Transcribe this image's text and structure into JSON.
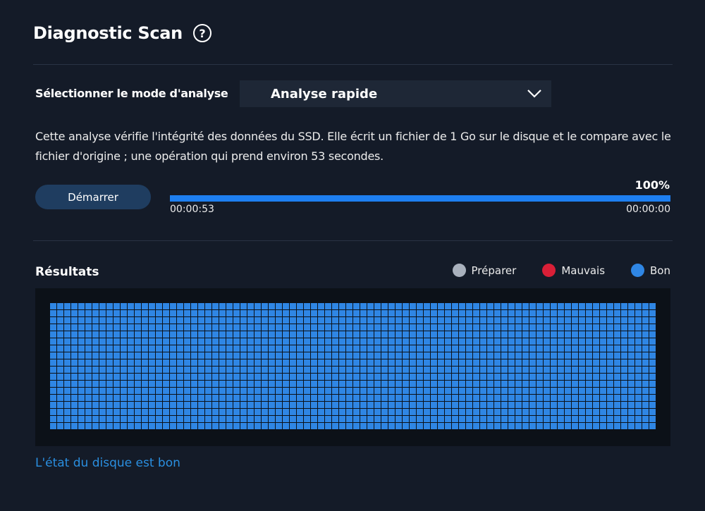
{
  "header": {
    "title": "Diagnostic Scan",
    "help_icon": "question-circle-icon",
    "help_glyph": "?"
  },
  "mode": {
    "label": "Sélectionner le mode d'analyse",
    "selected": "Analyse rapide",
    "dropdown_icon": "chevron-down-icon"
  },
  "description": "Cette analyse vérifie l'intégrité des données du SSD. Elle écrit un fichier de 1 Go sur le disque et le compare avec le fichier d'origine ; une opération qui prend environ 53 secondes.",
  "scan": {
    "start_label": "Démarrer",
    "progress_fraction": 1.0,
    "progress_text": "100%",
    "time_elapsed": "00:00:53",
    "time_remaining": "00:00:00"
  },
  "results": {
    "title": "Résultats",
    "legend": [
      {
        "label": "Préparer",
        "color": "#a9b1bd"
      },
      {
        "label": "Mauvais",
        "color": "#d91f37"
      },
      {
        "label": "Bon",
        "color": "#2f86e4"
      }
    ],
    "grid": {
      "columns": 86,
      "rows": 18,
      "status": "Bon"
    },
    "status_text": "L'état du disque est bon"
  },
  "colors": {
    "background": "#141b28",
    "accent": "#1e7ff0",
    "good": "#2f86e4",
    "status_text": "#2a8fe0"
  }
}
